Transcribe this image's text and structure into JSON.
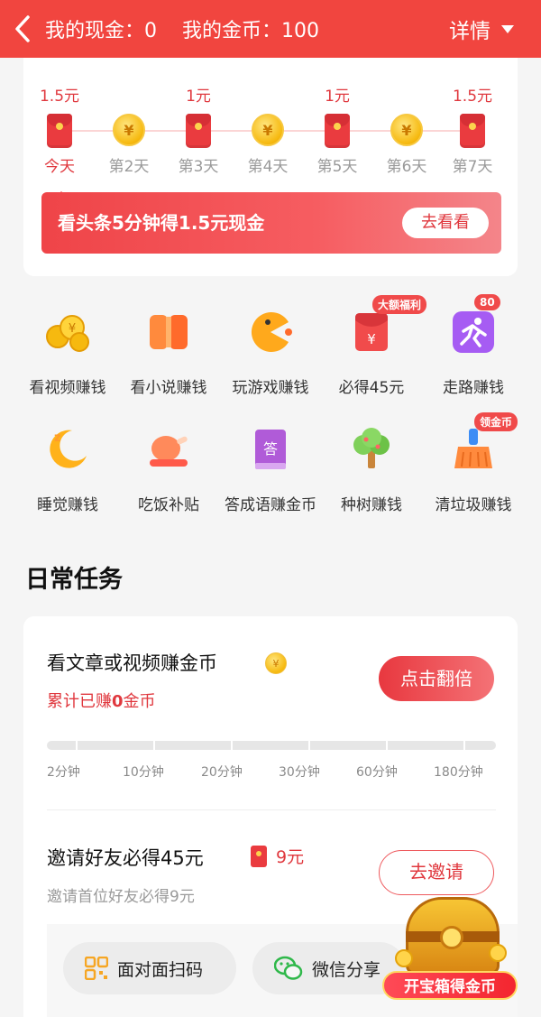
{
  "header": {
    "cash_label": "我的现金：0",
    "coin_label": "我的金币：100",
    "detail_label": "详情"
  },
  "checkin": {
    "days": [
      {
        "reward": "1.5元",
        "label": "今天",
        "kind": "envelope"
      },
      {
        "reward": "",
        "label": "第2天",
        "kind": "coin"
      },
      {
        "reward": "1元",
        "label": "第3天",
        "kind": "envelope"
      },
      {
        "reward": "",
        "label": "第4天",
        "kind": "coin"
      },
      {
        "reward": "1元",
        "label": "第5天",
        "kind": "envelope"
      },
      {
        "reward": "",
        "label": "第6天",
        "kind": "coin"
      },
      {
        "reward": "1.5元",
        "label": "第7天",
        "kind": "envelope"
      }
    ],
    "banner_text": "看头条5分钟得1.5元现金",
    "banner_button": "去看看"
  },
  "features": [
    {
      "label": "看视频赚钱",
      "icon": "coins-icon"
    },
    {
      "label": "看小说赚钱",
      "icon": "book-icon"
    },
    {
      "label": "玩游戏赚钱",
      "icon": "pacman-icon"
    },
    {
      "label": "必得45元",
      "icon": "red-envelope-icon",
      "badge": "大额福利"
    },
    {
      "label": "走路赚钱",
      "icon": "running-icon",
      "badge": "80"
    },
    {
      "label": "睡觉赚钱",
      "icon": "moon-icon"
    },
    {
      "label": "吃饭补贴",
      "icon": "chicken-icon"
    },
    {
      "label": "答成语赚金币",
      "icon": "quiz-book-icon"
    },
    {
      "label": "种树赚钱",
      "icon": "tree-icon"
    },
    {
      "label": "清垃圾赚钱",
      "icon": "broom-icon",
      "badge": "领金币"
    }
  ],
  "daily": {
    "section_title": "日常任务",
    "read_task": {
      "title": "看文章或视频赚金币",
      "earned_prefix": "累计已赚",
      "earned_value": "0",
      "earned_suffix": "金币",
      "button": "点击翻倍",
      "milestones": [
        "2分钟",
        "10分钟",
        "20分钟",
        "30分钟",
        "60分钟",
        "180分钟"
      ],
      "progress": 0
    },
    "invite_task": {
      "title": "邀请好友必得45元",
      "amount": "9元",
      "subtitle": "邀请首位好友必得9元",
      "button": "去邀请",
      "share_options": [
        "面对面扫码",
        "微信分享"
      ]
    }
  },
  "chest": {
    "label": "开宝箱得金币"
  },
  "colors": {
    "brand_red": "#f1453f",
    "accent_red": "#e0383e",
    "coin_gold": "#f6b90f"
  }
}
